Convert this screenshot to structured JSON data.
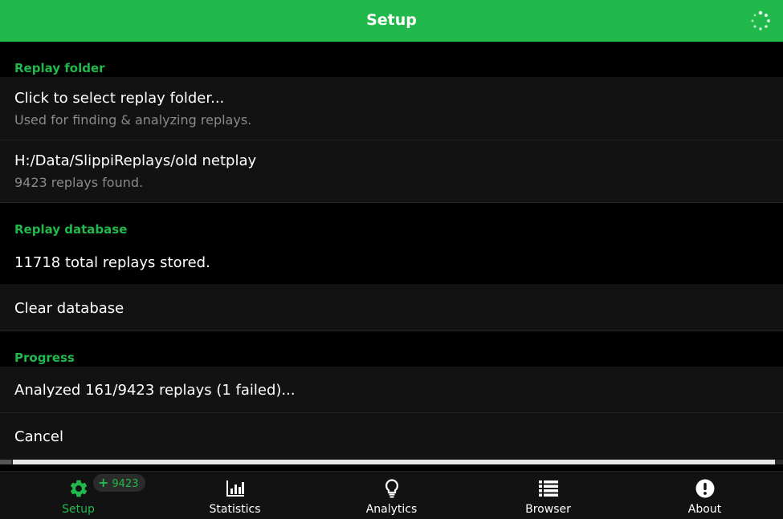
{
  "header": {
    "title": "Setup",
    "loading_icon": "spinner-icon"
  },
  "replay_folder": {
    "section_label": "Replay folder",
    "select_item": {
      "label": "Click to select replay folder...",
      "description": "Used for finding & analyzing replays."
    },
    "current_folder": {
      "path": "H:/Data/SlippiReplays/old netplay",
      "status": "9423 replays found."
    }
  },
  "replay_database": {
    "section_label": "Replay database",
    "stored_text": "11718 total replays stored.",
    "clear_label": "Clear database"
  },
  "progress": {
    "section_label": "Progress",
    "status_text": "Analyzed 161/9423 replays (1 failed)...",
    "cancel_label": "Cancel",
    "bar_fraction": 0.99
  },
  "bottom_nav": {
    "items": [
      {
        "label": "Setup",
        "icon": "gear-icon",
        "active": true
      },
      {
        "label": "Statistics",
        "icon": "bar-chart-icon"
      },
      {
        "label": "Analytics",
        "icon": "lightbulb-icon"
      },
      {
        "label": "Browser",
        "icon": "list-icon"
      },
      {
        "label": "About",
        "icon": "info-icon"
      }
    ],
    "badge": {
      "symbol": "+",
      "count": "9423"
    }
  },
  "colors": {
    "accent": "#21b94b",
    "background": "#000000",
    "row": "#121212",
    "secondary_text": "#8a8a8a"
  }
}
